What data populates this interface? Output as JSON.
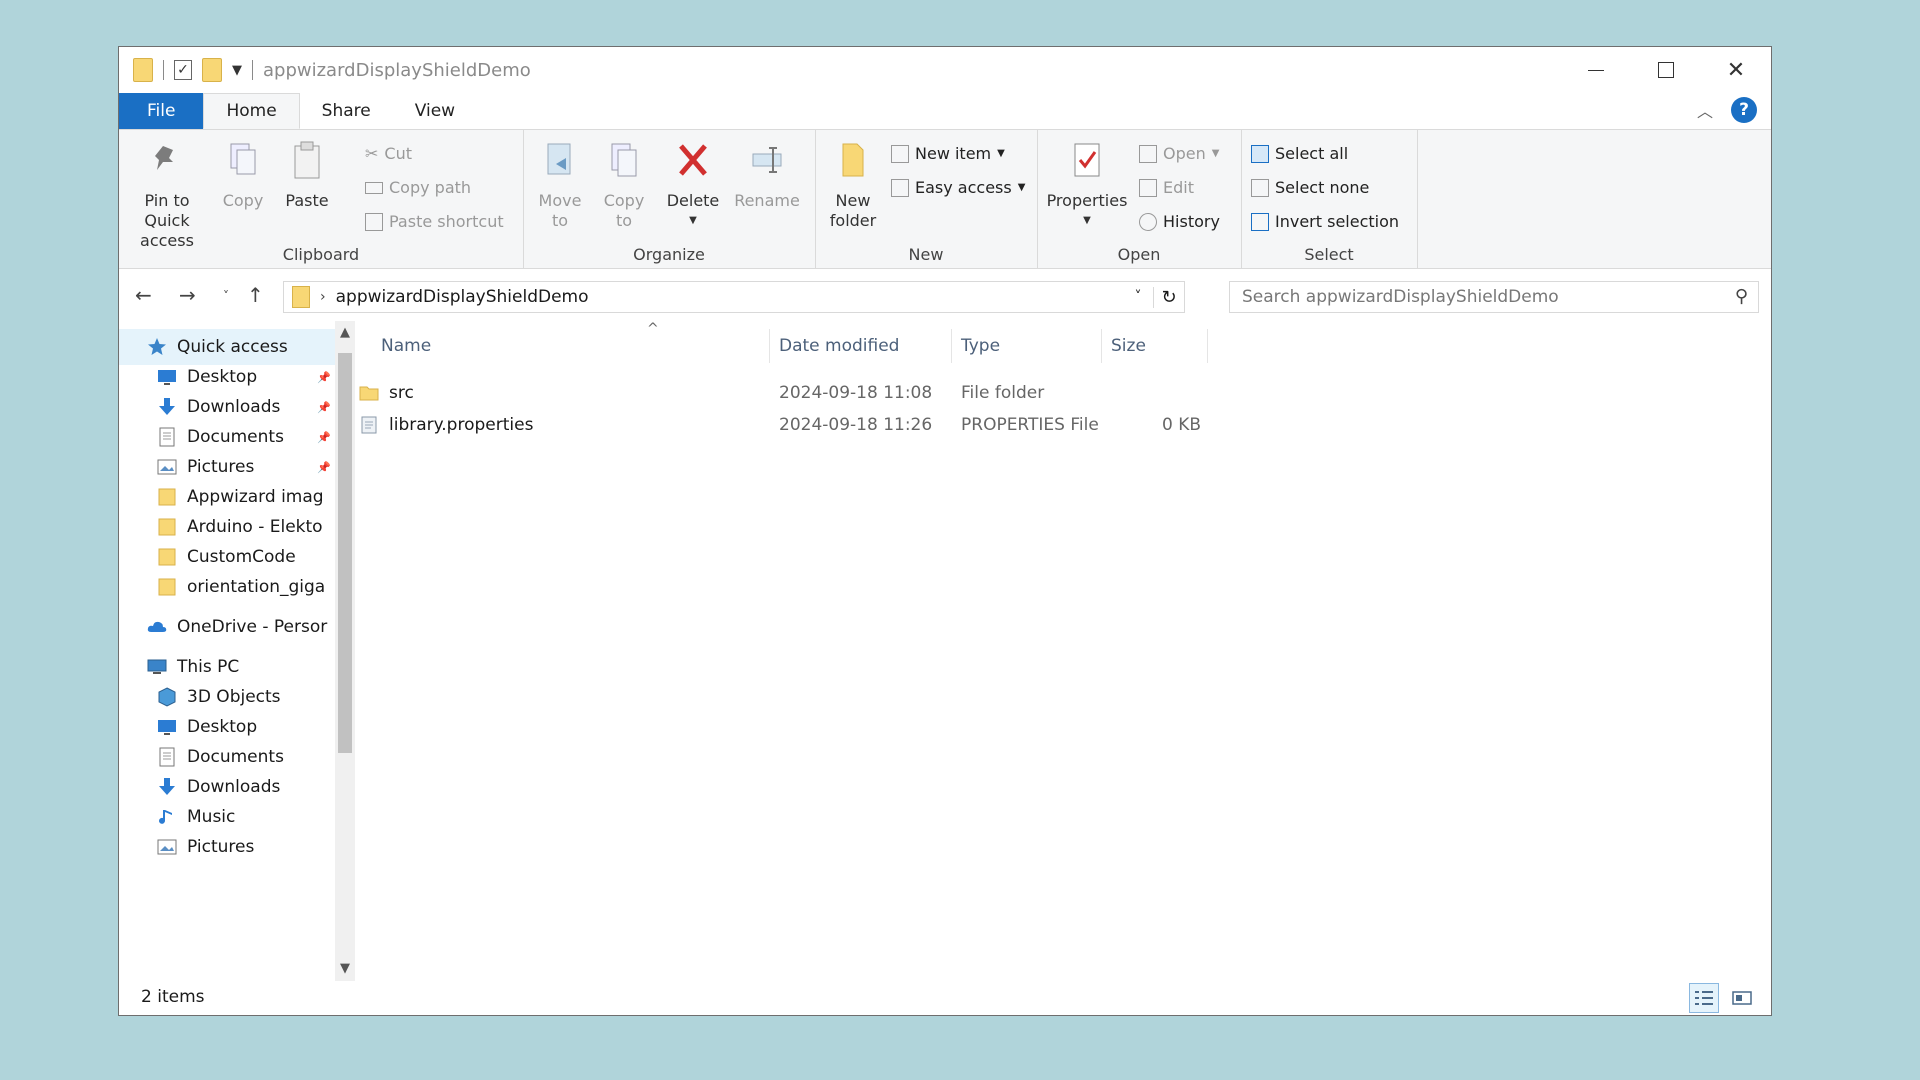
{
  "window": {
    "title": "appwizardDisplayShieldDemo"
  },
  "ribbon_tabs": [
    {
      "label": "File"
    },
    {
      "label": "Home"
    },
    {
      "label": "Share"
    },
    {
      "label": "View"
    }
  ],
  "ribbon": {
    "clipboard": {
      "label": "Clipboard",
      "pin": "Pin to Quick access",
      "pin_line1": "Pin to Quick",
      "pin_line2": "access",
      "copy": "Copy",
      "paste": "Paste",
      "cut": "Cut",
      "copy_path": "Copy path",
      "paste_shortcut": "Paste shortcut"
    },
    "organize": {
      "label": "Organize",
      "move_to_1": "Move",
      "move_to_2": "to",
      "copy_to_1": "Copy",
      "copy_to_2": "to",
      "delete": "Delete",
      "rename": "Rename"
    },
    "new": {
      "label": "New",
      "new_folder_1": "New",
      "new_folder_2": "folder",
      "new_item": "New item",
      "easy_access": "Easy access"
    },
    "open": {
      "label": "Open",
      "properties": "Properties",
      "open": "Open",
      "edit": "Edit",
      "history": "History"
    },
    "select": {
      "label": "Select",
      "select_all": "Select all",
      "select_none": "Select none",
      "invert": "Invert selection"
    }
  },
  "address": {
    "path": "appwizardDisplayShieldDemo",
    "search_placeholder": "Search appwizardDisplayShieldDemo"
  },
  "sidebar": {
    "items": [
      {
        "label": "Quick access",
        "icon": "star-icon",
        "pinned": false
      },
      {
        "label": "Desktop",
        "icon": "desktop-icon",
        "pinned": true
      },
      {
        "label": "Downloads",
        "icon": "download-icon",
        "pinned": true
      },
      {
        "label": "Documents",
        "icon": "document-icon",
        "pinned": true
      },
      {
        "label": "Pictures",
        "icon": "picture-icon",
        "pinned": true
      },
      {
        "label": "Appwizard imag",
        "icon": "folder-icon",
        "pinned": false
      },
      {
        "label": "Arduino - Elekto",
        "icon": "folder-icon",
        "pinned": false
      },
      {
        "label": "CustomCode",
        "icon": "folder-icon",
        "pinned": false
      },
      {
        "label": "orientation_giga",
        "icon": "folder-icon",
        "pinned": false
      },
      {
        "label": "OneDrive - Persor",
        "icon": "cloud-icon",
        "pinned": false
      },
      {
        "label": "This PC",
        "icon": "computer-icon",
        "pinned": false
      },
      {
        "label": "3D Objects",
        "icon": "cube-icon",
        "pinned": false
      },
      {
        "label": "Desktop",
        "icon": "desktop-icon",
        "pinned": false
      },
      {
        "label": "Documents",
        "icon": "document-icon",
        "pinned": false
      },
      {
        "label": "Downloads",
        "icon": "download-icon",
        "pinned": false
      },
      {
        "label": "Music",
        "icon": "music-icon",
        "pinned": false
      },
      {
        "label": "Pictures",
        "icon": "picture-icon",
        "pinned": false
      }
    ]
  },
  "table": {
    "columns": [
      "Name",
      "Date modified",
      "Type",
      "Size"
    ],
    "rows": [
      {
        "name": "src",
        "date": "2024-09-18 11:08",
        "type": "File folder",
        "size": "",
        "icon": "folder-icon"
      },
      {
        "name": "library.properties",
        "date": "2024-09-18 11:26",
        "type": "PROPERTIES File",
        "size": "0 KB",
        "icon": "file-icon"
      }
    ]
  },
  "status": {
    "count": "2 items"
  },
  "colors": {
    "accent": "#1a6fc4",
    "folder": "#f8d775",
    "delete": "#d1302f"
  }
}
